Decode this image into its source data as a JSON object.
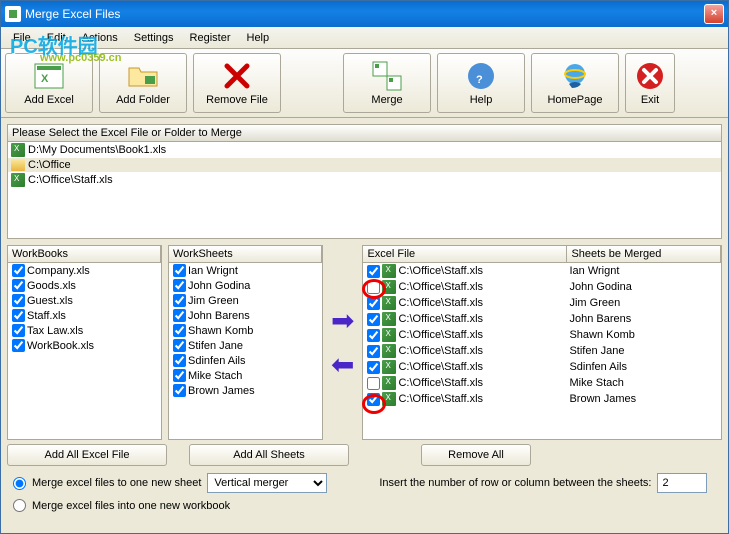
{
  "window": {
    "title": "Merge Excel Files"
  },
  "menu": {
    "file": "File",
    "edit": "Edit",
    "actions": "Actions",
    "settings": "Settings",
    "register": "Register",
    "help": "Help"
  },
  "watermark": {
    "main": "PC软件园",
    "sub": "www.pc0359.cn"
  },
  "toolbar": {
    "add_excel": "Add Excel",
    "add_folder": "Add Folder",
    "remove_file": "Remove File",
    "merge": "Merge",
    "help": "Help",
    "homepage": "HomePage",
    "exit": "Exit"
  },
  "file_panel": {
    "header": "Please Select the Excel File or Folder to Merge",
    "items": [
      {
        "type": "xls",
        "path": "D:\\My Documents\\Book1.xls"
      },
      {
        "type": "folder",
        "path": "C:\\Office"
      },
      {
        "type": "xls",
        "path": "C:\\Office\\Staff.xls"
      }
    ]
  },
  "workbooks": {
    "header": "WorkBooks",
    "items": [
      "Company.xls",
      "Goods.xls",
      "Guest.xls",
      "Staff.xls",
      "Tax Law.xls",
      "WorkBook.xls"
    ]
  },
  "worksheets": {
    "header": "WorkSheets",
    "items": [
      "Ian Wrignt",
      "John Godina",
      "Jim Green",
      "John Barens",
      "Shawn Komb",
      "Stifen Jane",
      "Sdinfen Ails",
      "Mike Stach",
      "Brown James"
    ]
  },
  "excel_files": {
    "col1": "Excel File",
    "col2": "Sheets be Merged",
    "items": [
      {
        "file": "C:\\Office\\Staff.xls",
        "sheet": "Ian Wrignt",
        "checked": true
      },
      {
        "file": "C:\\Office\\Staff.xls",
        "sheet": "John Godina",
        "checked": false
      },
      {
        "file": "C:\\Office\\Staff.xls",
        "sheet": "Jim Green",
        "checked": true
      },
      {
        "file": "C:\\Office\\Staff.xls",
        "sheet": "John Barens",
        "checked": true
      },
      {
        "file": "C:\\Office\\Staff.xls",
        "sheet": "Shawn Komb",
        "checked": true
      },
      {
        "file": "C:\\Office\\Staff.xls",
        "sheet": "Stifen Jane",
        "checked": true
      },
      {
        "file": "C:\\Office\\Staff.xls",
        "sheet": "Sdinfen Ails",
        "checked": true
      },
      {
        "file": "C:\\Office\\Staff.xls",
        "sheet": "Mike Stach",
        "checked": false
      },
      {
        "file": "C:\\Office\\Staff.xls",
        "sheet": "Brown James",
        "checked": true
      }
    ]
  },
  "buttons": {
    "add_all_excel": "Add All Excel File",
    "add_all_sheets": "Add All Sheets",
    "remove_all": "Remove All"
  },
  "options": {
    "radio1": "Merge excel files to one new sheet",
    "radio2": "Merge excel files into one new workbook",
    "merge_type": "Vertical merger",
    "insert_label": "Insert the number of row or column between the sheets:",
    "insert_value": "2"
  }
}
